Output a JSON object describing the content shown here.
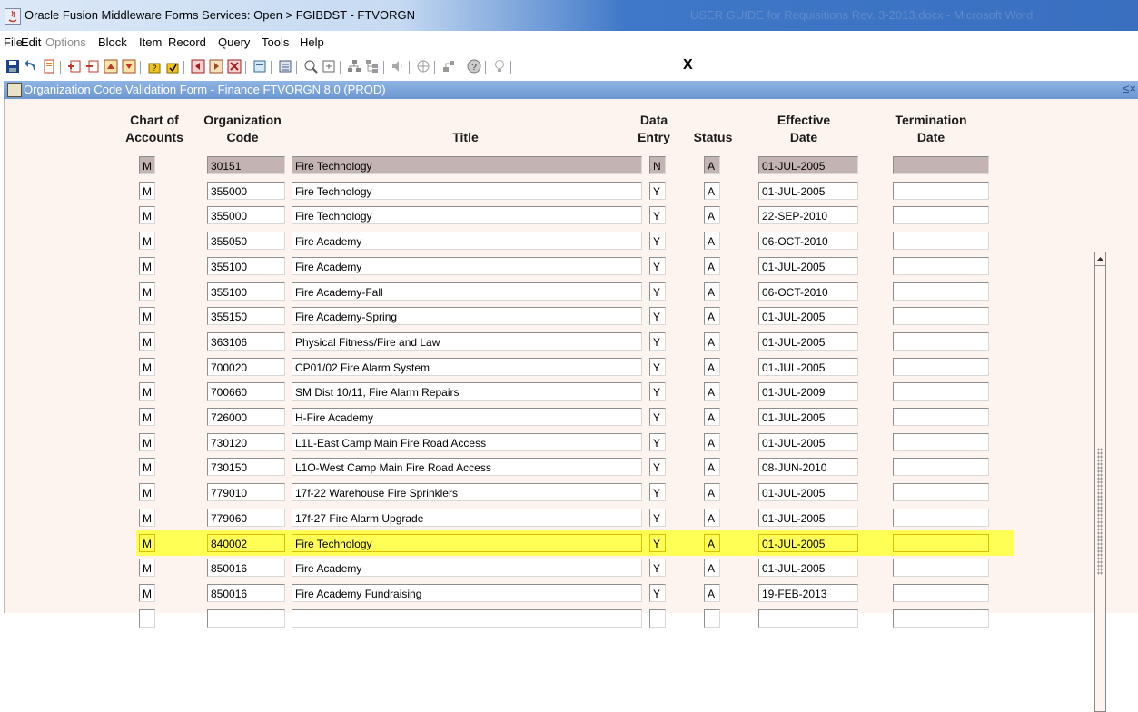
{
  "window": {
    "title": "Oracle Fusion Middleware Forms Services:  Open > FGIBDST - FTVORGN",
    "background_title": "USER GUIDE for Requisitions  Rev. 3-2013.docx - Microsoft Word"
  },
  "menu": {
    "items": [
      "File",
      "Edit",
      "Options",
      "Block",
      "Item",
      "Record",
      "Query",
      "Tools",
      "Help"
    ]
  },
  "toolbar": {
    "icons": [
      "save-icon",
      "rollback-icon",
      "print-icon",
      "insert-record-icon",
      "remove-record-icon",
      "previous-block-icon",
      "next-block-icon",
      "enter-query-icon",
      "execute-query-icon",
      "previous-record-icon",
      "next-record-icon",
      "clear-record-icon",
      "clear-form-icon",
      "options-icon",
      "help-icon",
      "exit-icon"
    ],
    "exit_label": "X"
  },
  "form": {
    "title": "Organization Code Validation Form - Finance  FTVORGN  8.0  (PROD)",
    "controls": "≤×"
  },
  "columns": {
    "coa": "Chart of\nAccounts",
    "org_code": "Organization\nCode",
    "title": "Title",
    "data_entry": "Data\nEntry",
    "status": "Status",
    "eff_date": "Effective\nDate",
    "term_date": "Termination\nDate"
  },
  "rows": [
    {
      "coa": "M",
      "org": "30151",
      "title": "Fire Technology",
      "de": "N",
      "status": "A",
      "eff": "01-JUL-2005",
      "term": ""
    },
    {
      "coa": "M",
      "org": "355000",
      "title": "Fire Technology",
      "de": "Y",
      "status": "A",
      "eff": "01-JUL-2005",
      "term": ""
    },
    {
      "coa": "M",
      "org": "355000",
      "title": "Fire Technology",
      "de": "Y",
      "status": "A",
      "eff": "22-SEP-2010",
      "term": ""
    },
    {
      "coa": "M",
      "org": "355050",
      "title": "Fire Academy",
      "de": "Y",
      "status": "A",
      "eff": "06-OCT-2010",
      "term": ""
    },
    {
      "coa": "M",
      "org": "355100",
      "title": "Fire Academy",
      "de": "Y",
      "status": "A",
      "eff": "01-JUL-2005",
      "term": ""
    },
    {
      "coa": "M",
      "org": "355100",
      "title": "Fire Academy-Fall",
      "de": "Y",
      "status": "A",
      "eff": "06-OCT-2010",
      "term": ""
    },
    {
      "coa": "M",
      "org": "355150",
      "title": "Fire Academy-Spring",
      "de": "Y",
      "status": "A",
      "eff": "01-JUL-2005",
      "term": ""
    },
    {
      "coa": "M",
      "org": "363106",
      "title": "Physical Fitness/Fire and Law",
      "de": "Y",
      "status": "A",
      "eff": "01-JUL-2005",
      "term": ""
    },
    {
      "coa": "M",
      "org": "700020",
      "title": "CP01/02 Fire Alarm System",
      "de": "Y",
      "status": "A",
      "eff": "01-JUL-2005",
      "term": ""
    },
    {
      "coa": "M",
      "org": "700660",
      "title": "SM Dist 10/11, Fire Alarm Repairs",
      "de": "Y",
      "status": "A",
      "eff": "01-JUL-2009",
      "term": ""
    },
    {
      "coa": "M",
      "org": "726000",
      "title": "H-Fire Academy",
      "de": "Y",
      "status": "A",
      "eff": "01-JUL-2005",
      "term": ""
    },
    {
      "coa": "M",
      "org": "730120",
      "title": "L1L-East Camp Main Fire Road Access",
      "de": "Y",
      "status": "A",
      "eff": "01-JUL-2005",
      "term": ""
    },
    {
      "coa": "M",
      "org": "730150",
      "title": "L1O-West Camp Main Fire Road Access",
      "de": "Y",
      "status": "A",
      "eff": "08-JUN-2010",
      "term": ""
    },
    {
      "coa": "M",
      "org": "779010",
      "title": "17f-22 Warehouse Fire Sprinklers",
      "de": "Y",
      "status": "A",
      "eff": "01-JUL-2005",
      "term": ""
    },
    {
      "coa": "M",
      "org": "779060",
      "title": "17f-27 Fire Alarm Upgrade",
      "de": "Y",
      "status": "A",
      "eff": "01-JUL-2005",
      "term": ""
    },
    {
      "coa": "M",
      "org": "840002",
      "title": "Fire Technology",
      "de": "Y",
      "status": "A",
      "eff": "01-JUL-2005",
      "term": ""
    },
    {
      "coa": "M",
      "org": "850016",
      "title": "Fire Academy",
      "de": "Y",
      "status": "A",
      "eff": "01-JUL-2005",
      "term": ""
    },
    {
      "coa": "M",
      "org": "850016",
      "title": "Fire Academy Fundraising",
      "de": "Y",
      "status": "A",
      "eff": "19-FEB-2013",
      "term": ""
    },
    {
      "coa": "",
      "org": "",
      "title": "",
      "de": "",
      "status": "",
      "eff": "",
      "term": ""
    }
  ],
  "current_record_index": 0,
  "highlighted_record_index": 15,
  "colors": {
    "highlight": "#ffff55",
    "current_record": "#c4b3b3",
    "canvas": "#fdf4f0",
    "form_titlebar": "#7aa2d8"
  }
}
